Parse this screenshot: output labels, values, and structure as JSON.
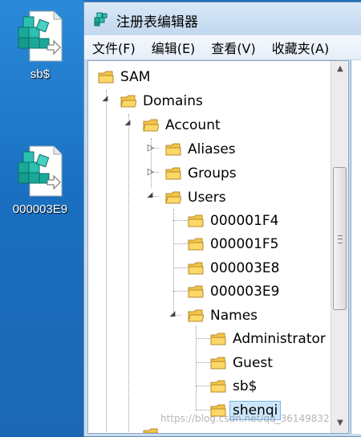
{
  "desktop": {
    "icons": [
      {
        "label": "sb$",
        "icon": "registry-file-icon"
      },
      {
        "label": "000003E9",
        "icon": "registry-file-icon"
      }
    ]
  },
  "window": {
    "title": "注册表编辑器",
    "menu": [
      "文件(F)",
      "编辑(E)",
      "查看(V)",
      "收藏夹(A)"
    ]
  },
  "tree": {
    "root": "SAM",
    "domains": "Domains",
    "account": "Account",
    "aliases": "Aliases",
    "groups": "Groups",
    "users": "Users",
    "rids": [
      "000001F4",
      "000001F5",
      "000003E8",
      "000003E9"
    ],
    "names": "Names",
    "name_items": [
      "Administrator",
      "Guest",
      "sb$",
      "shenqi"
    ],
    "selected": "shenqi"
  },
  "watermark": "https://blog.csdn.net/qq_36149832"
}
